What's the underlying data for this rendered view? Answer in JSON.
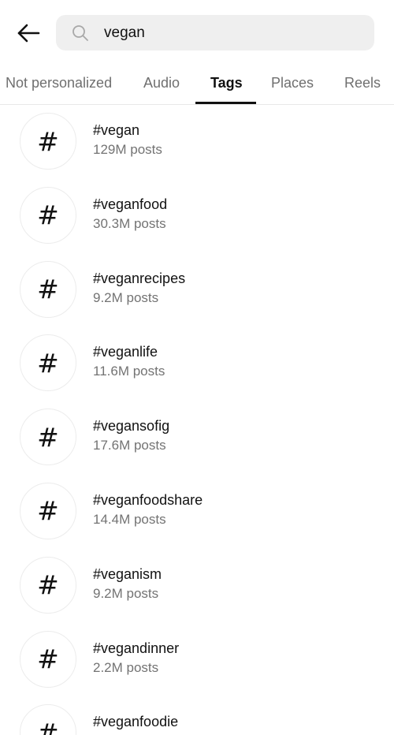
{
  "header": {
    "back_icon": "arrow-left-icon",
    "search_icon": "search-icon",
    "search_value": "vegan"
  },
  "tabs": [
    {
      "label": "Not personalized",
      "active": false
    },
    {
      "label": "Audio",
      "active": false
    },
    {
      "label": "Tags",
      "active": true
    },
    {
      "label": "Places",
      "active": false
    },
    {
      "label": "Reels",
      "active": false
    }
  ],
  "tags": [
    {
      "symbol": "#",
      "name": "#vegan",
      "count": "129M posts"
    },
    {
      "symbol": "#",
      "name": "#veganfood",
      "count": "30.3M posts"
    },
    {
      "symbol": "#",
      "name": "#veganrecipes",
      "count": "9.2M posts"
    },
    {
      "symbol": "#",
      "name": "#veganlife",
      "count": "11.6M posts"
    },
    {
      "symbol": "#",
      "name": "#vegansofig",
      "count": "17.6M posts"
    },
    {
      "symbol": "#",
      "name": "#veganfoodshare",
      "count": "14.4M posts"
    },
    {
      "symbol": "#",
      "name": "#veganism",
      "count": "9.2M posts"
    },
    {
      "symbol": "#",
      "name": "#vegandinner",
      "count": "2.2M posts"
    },
    {
      "symbol": "#",
      "name": "#veganfoodie",
      "count": ""
    }
  ],
  "colors": {
    "search_bg": "#efefef",
    "text_primary": "#111111",
    "text_secondary": "#737373",
    "tab_inactive": "#6f6f6f",
    "divider": "#e8e8e8"
  }
}
